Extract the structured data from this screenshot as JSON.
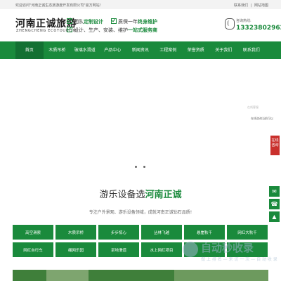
{
  "topbar": {
    "welcome": "欢迎访问\"河南正诚生态旅游度开发有限公司\"官方网站!",
    "links": [
      "联系我们",
      "|",
      "网站地图"
    ]
  },
  "header": {
    "logo_cn": "河南正诚旅游",
    "logo_en": "ZHENGCHENG ECOTOURISM",
    "slogan1_a": "团队",
    "slogan1_b": "定制设计",
    "slogan2_a": "质保一年",
    "slogan2_b": "终身维护",
    "slogan3_a": "设计、生产、安装、维护",
    "slogan3_b": "一站式服务商",
    "hotline_label": "咨询热线:",
    "hotline_number": "13323802962"
  },
  "nav": [
    "首页",
    "木质吊桥",
    "玻璃水滑道",
    "产品中心",
    "新闻资讯",
    "工程案例",
    "荣誉资质",
    "关于我们",
    "联系我们"
  ],
  "section": {
    "title_a": "游乐设备选",
    "title_b": "河南正诚",
    "subtitle": "专注户外景观、游乐设备领域，成就河南正诚钻石品质!"
  },
  "categories": [
    "高空滑索",
    "木质吊桥",
    "步步惊心",
    "丛林飞越",
    "悬崖秋千",
    "网红大秋千",
    "网红自行车",
    "绳网乐园",
    "旱地滑道",
    "水上网红项目",
    "",
    ""
  ],
  "float": {
    "chat_faint": "在线客服",
    "chat_badge": "在线咨询当前可以",
    "online_label": "在线咨询",
    "wechat": "☎",
    "top": "▲"
  },
  "watermark": {
    "title": "自动秒收录",
    "sub": "做 上 排 名 — 来 访 一 次 — 自 动 收 录"
  },
  "colors": {
    "accent": "#1a8a3c",
    "accent_dark": "#137032",
    "alert": "#c9302c"
  }
}
